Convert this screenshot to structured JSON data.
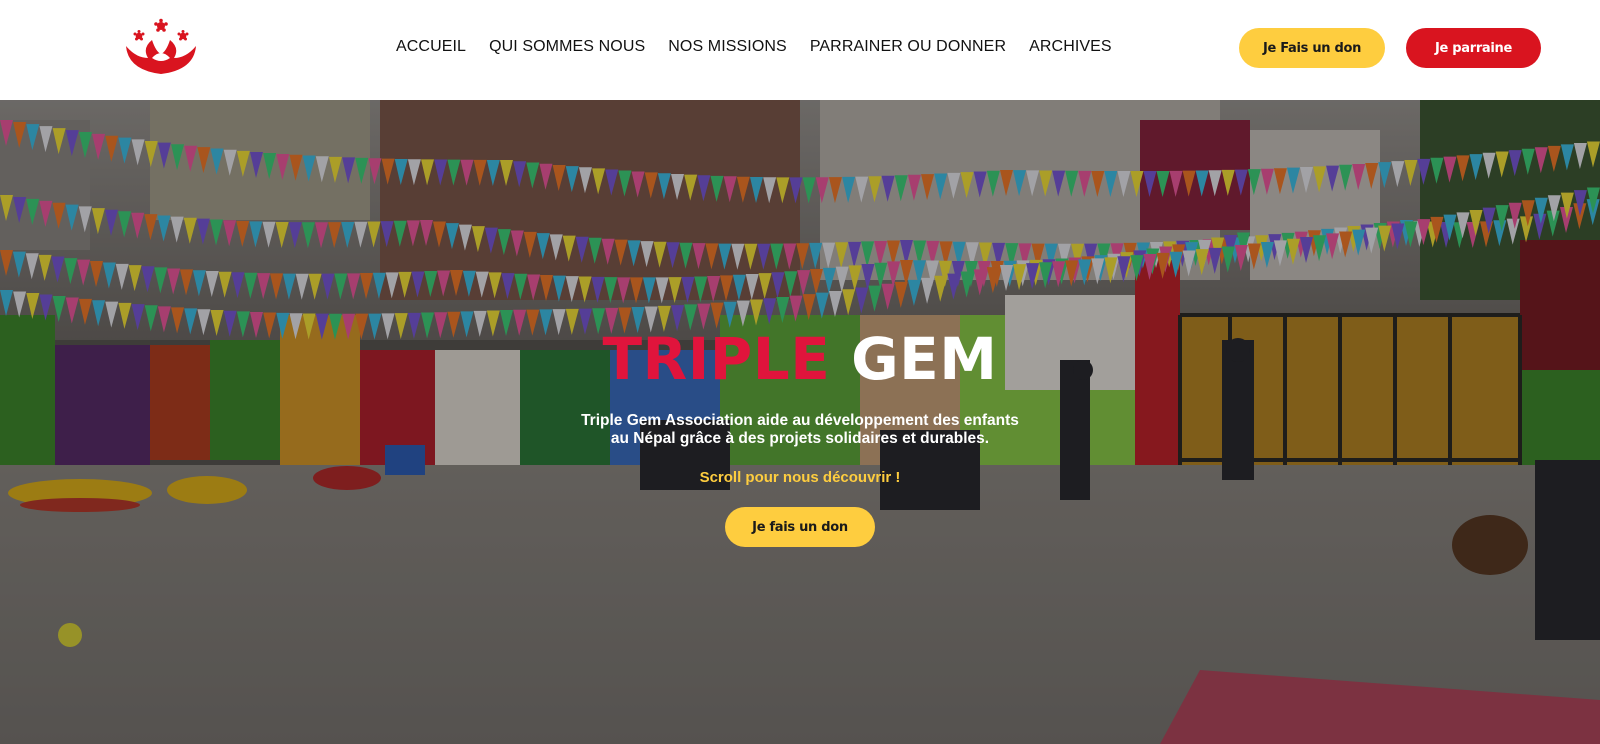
{
  "header": {
    "logo_icon": "lotus-logo-icon",
    "nav": [
      {
        "label": "ACCUEIL"
      },
      {
        "label": "QUI SOMMES NOUS"
      },
      {
        "label": "NOS MISSIONS"
      },
      {
        "label": "PARRAINER OU DONNER"
      },
      {
        "label": "ARCHIVES"
      }
    ],
    "donate_label": "Je Fais un don",
    "sponsor_label": "Je parraine"
  },
  "hero": {
    "title_part1": "TRIPLE",
    "title_part2": "GEM",
    "description_line1": "Triple Gem Association aide au développement des enfants",
    "description_line2": "au Népal grâce à des projets solidaires et durables.",
    "scroll_text": "Scroll pour nous découvrir !",
    "cta_label": "Je fais un don"
  },
  "colors": {
    "brand_red": "#d9141f",
    "title_red": "#e0143c",
    "accent_yellow": "#fecd3f",
    "nav_text": "#111111"
  }
}
